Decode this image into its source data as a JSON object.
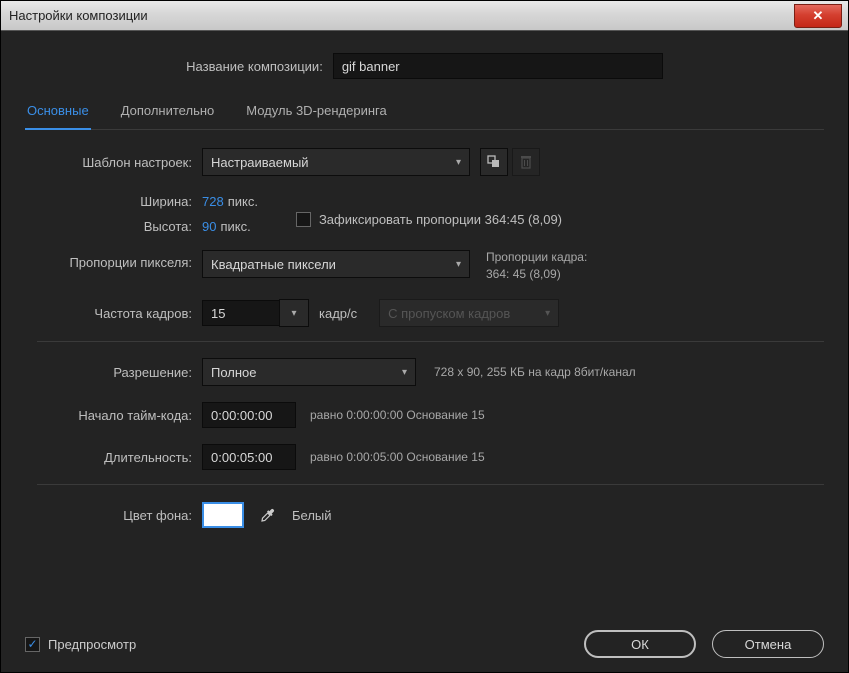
{
  "titlebar": {
    "title": "Настройки композиции"
  },
  "name": {
    "label": "Название композиции:",
    "value": "gif banner"
  },
  "tabs": {
    "basic": "Основные",
    "advanced": "Дополнительно",
    "renderer": "Модуль 3D-рендеринга"
  },
  "preset": {
    "label": "Шаблон настроек:",
    "value": "Настраиваемый"
  },
  "width": {
    "label": "Ширина:",
    "value": "728",
    "unit": "пикс."
  },
  "height": {
    "label": "Высота:",
    "value": "90",
    "unit": "пикс."
  },
  "lockAspect": {
    "label": "Зафиксировать пропорции 364:45 (8,09)"
  },
  "pixelAspect": {
    "label": "Пропорции пикселя:",
    "value": "Квадратные пиксели"
  },
  "frameAspect": {
    "label": "Пропорции кадра:",
    "value": "364: 45 (8,09)"
  },
  "frameRate": {
    "label": "Частота кадров:",
    "value": "15",
    "unit": "кадр/с",
    "dropDisabled": "С пропуском кадров"
  },
  "resolution": {
    "label": "Разрешение:",
    "value": "Полное",
    "info": "728 x 90, 255 КБ на кадр 8бит/канал"
  },
  "startTC": {
    "label": "Начало тайм-кода:",
    "value": "0:00:00:00",
    "info": "равно 0:00:00:00  Основание 15"
  },
  "duration": {
    "label": "Длительность:",
    "value": "0:00:05:00",
    "info": "равно 0:00:05:00  Основание 15"
  },
  "bgColor": {
    "label": "Цвет фона:",
    "name": "Белый",
    "hex": "#ffffff"
  },
  "footer": {
    "preview": "Предпросмотр",
    "ok": "ОК",
    "cancel": "Отмена"
  }
}
